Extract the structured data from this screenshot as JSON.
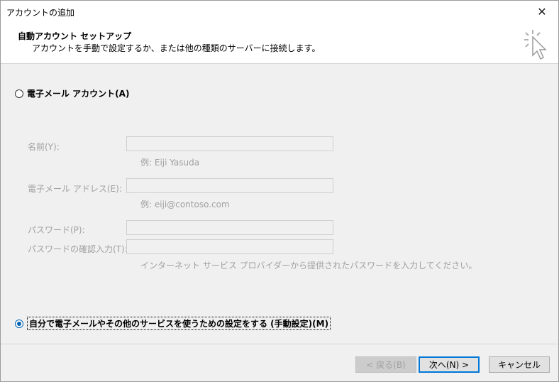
{
  "window": {
    "title": "アカウントの追加",
    "close_label": "✕"
  },
  "header": {
    "title": "自動アカウント セットアップ",
    "subtitle": "アカウントを手動で設定するか、または他の種類のサーバーに接続します。",
    "icon": "wizard-cursor-icon"
  },
  "email_option": {
    "label": "電子メール アカウント(A)",
    "selected": false
  },
  "fields": {
    "name_label": "名前(Y):",
    "name_hint": "例: Eiji Yasuda",
    "email_label": "電子メール アドレス(E):",
    "email_hint": "例: eiji@contoso.com",
    "password_label": "パスワード(P):",
    "password_confirm_label": "パスワードの確認入力(T):",
    "password_hint": "インターネット サービス プロバイダーから提供されたパスワードを入力してください。"
  },
  "manual_option": {
    "label": "自分で電子メールやその他のサービスを使うための設定をする (手動設定)(M)",
    "selected": true
  },
  "buttons": {
    "back": "< 戻る(B)",
    "next": "次へ(N) >",
    "cancel": "キャンセル"
  },
  "colors": {
    "accent": "#0078d7",
    "disabled_text": "#a0a0a0",
    "dialog_bg": "#f0f0f0"
  }
}
